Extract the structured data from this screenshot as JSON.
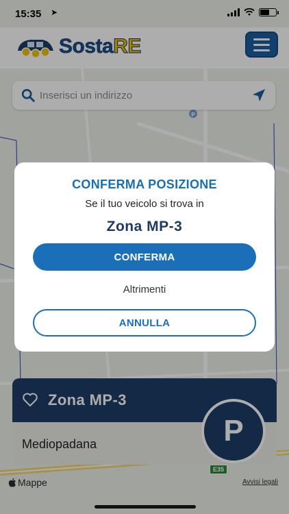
{
  "status_bar": {
    "time": "15:35"
  },
  "header": {
    "logo_text_main": "Sosta",
    "logo_text_accent": "RE"
  },
  "search": {
    "placeholder": "Inserisci un indirizzo"
  },
  "dialog": {
    "title": "CONFERMA POSIZIONE",
    "subtitle": "Se il tuo veicolo si trova in",
    "zone": "Zona MP-3",
    "confirm_label": "CONFERMA",
    "or_label": "Altrimenti",
    "cancel_label": "ANNULLA"
  },
  "zone_card": {
    "name": "Zona MP-3",
    "area": "Mediopadana",
    "badge": "P"
  },
  "map_footer": {
    "attribution": "Mappe",
    "legal": "Avvisi legali",
    "road_shield": "E35"
  },
  "colors": {
    "primary": "#1a6fb8",
    "dark_blue": "#1c3d66",
    "accent_yellow": "#f2c300"
  }
}
